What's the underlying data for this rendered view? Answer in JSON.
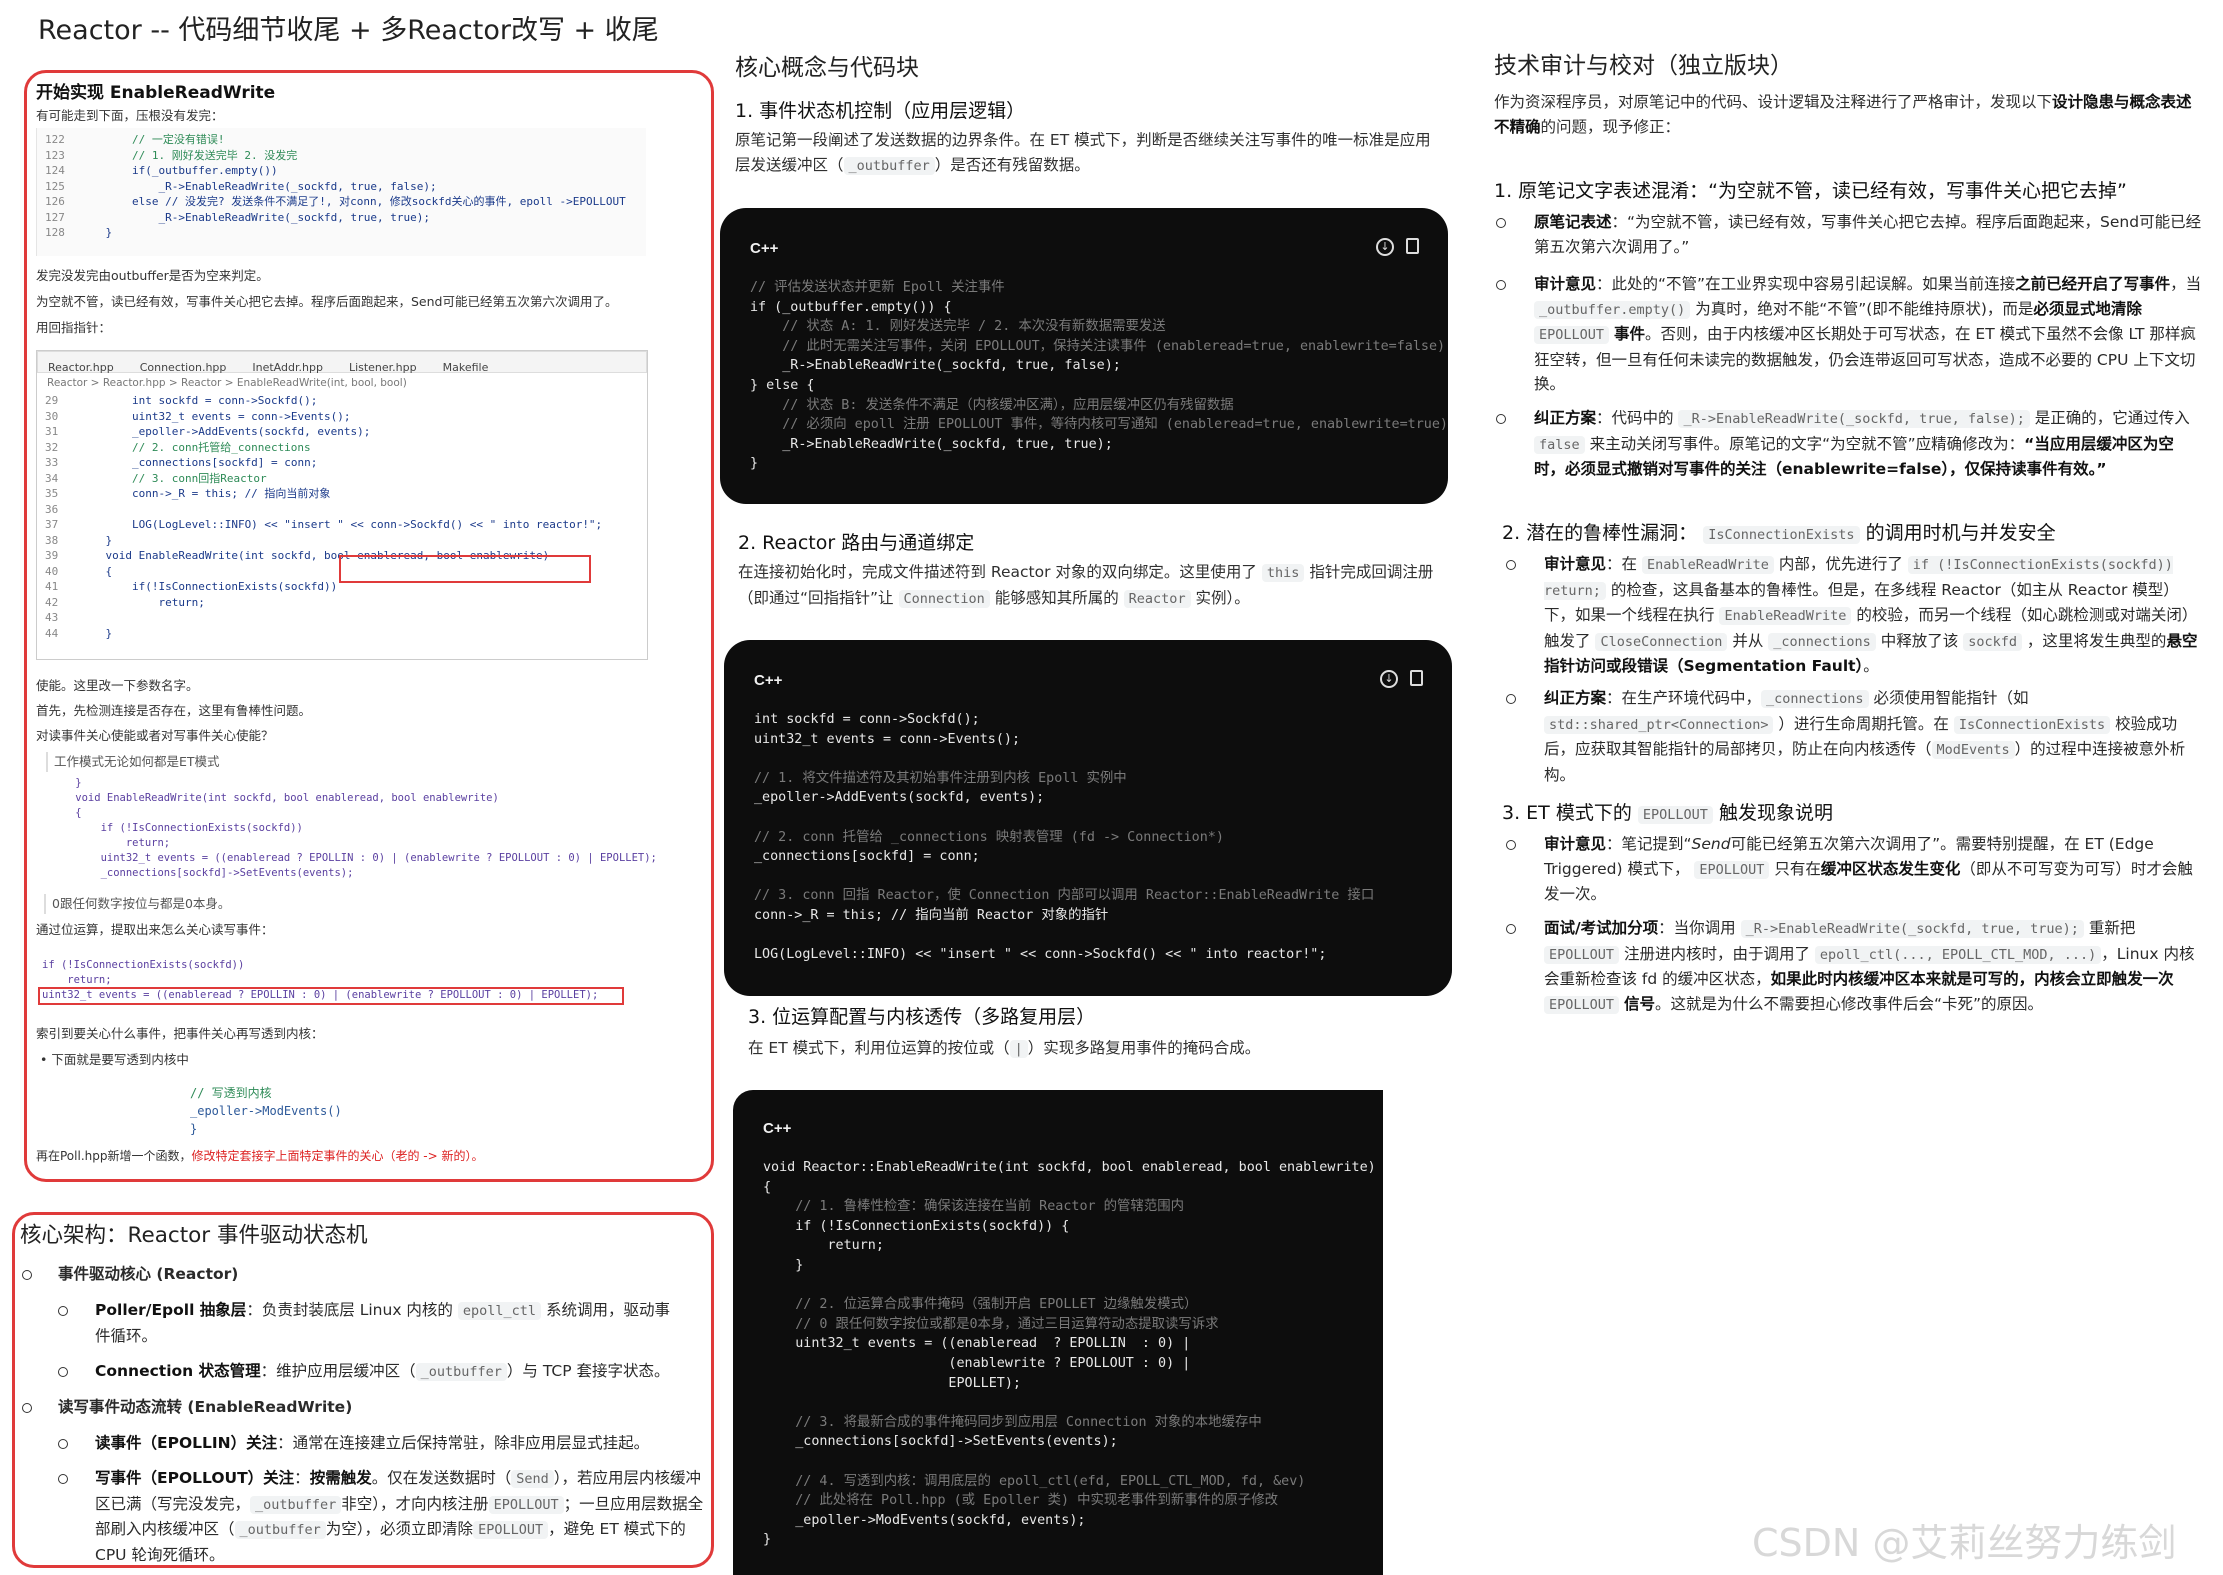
{
  "page_title": "Reactor -- 代码细节收尾 + 多Reactor改写 + 收尾",
  "watermark": "CSDN @艾莉丝努力练剑",
  "left_panel": {
    "heading": "开始实现 EnableReadWrite",
    "intro": "有可能走到下面，压根没有发完：",
    "code1": [
      {
        "n": "122",
        "t": "        // 一定没有错误!"
      },
      {
        "n": "123",
        "t": "        // 1. 刚好发送完毕 2. 没发完"
      },
      {
        "n": "124",
        "t": "        if(_outbuffer.empty())"
      },
      {
        "n": "125",
        "t": "            _R->EnableReadWrite(_sockfd, true, false);"
      },
      {
        "n": "126",
        "t": "        else // 没发完? 发送条件不满足了!, 对conn, 修改sockfd关心的事件, epoll ->EPOLLOUT"
      },
      {
        "n": "127",
        "t": "            _R->EnableReadWrite(_sockfd, true, true);"
      },
      {
        "n": "128",
        "t": "    }"
      }
    ],
    "p1": "发完没发完由outbuffer是否为空来判定。",
    "p2": "为空就不管，读已经有效，写事件关心把它去掉。程序后面跑起来，Send可能已经第五次第六次调用了。",
    "p3": "用回指指针：",
    "tabs": [
      "Reactor.hpp",
      "Connection.hpp",
      "InetAddr.hpp",
      "Listener.hpp",
      "Makefile"
    ],
    "crumbs": "Reactor > Reactor.hpp > Reactor > EnableReadWrite(int, bool, bool)",
    "code2": [
      {
        "n": "29",
        "t": "        int sockfd = conn->Sockfd();"
      },
      {
        "n": "30",
        "t": "        uint32_t events = conn->Events();"
      },
      {
        "n": "31",
        "t": "        _epoller->AddEvents(sockfd, events);"
      },
      {
        "n": "32",
        "t": "        // 2. conn托管给_connections"
      },
      {
        "n": "33",
        "t": "        _connections[sockfd] = conn;"
      },
      {
        "n": "34",
        "t": "        // 3. conn回指Reactor"
      },
      {
        "n": "35",
        "t": "        conn->_R = this; // 指向当前对象"
      },
      {
        "n": "36",
        "t": ""
      },
      {
        "n": "37",
        "t": "        LOG(LogLevel::INFO) << \"insert \" << conn->Sockfd() << \" into reactor!\";"
      },
      {
        "n": "38",
        "t": "    }"
      },
      {
        "n": "39",
        "t": "    void EnableReadWrite(int sockfd, bool enableread, bool enablewrite)"
      },
      {
        "n": "40",
        "t": "    {"
      },
      {
        "n": "41",
        "t": "        if(!IsConnectionExists(sockfd))"
      },
      {
        "n": "42",
        "t": "            return;"
      },
      {
        "n": "43",
        "t": ""
      },
      {
        "n": "44",
        "t": "    }"
      }
    ],
    "p4": "使能。这里改一下参数名字。",
    "p5": "首先，先检测连接是否存在，这里有鲁棒性问题。",
    "p6": "对读事件关心使能或者对写事件关心使能？",
    "p7": "工作模式无论如何都是ET模式",
    "code3": [
      "    }",
      "    void EnableReadWrite(int sockfd, bool enableread, bool enablewrite)",
      "    {",
      "        if (!IsConnectionExists(sockfd))",
      "            return;",
      "        uint32_t events = ((enableread ? EPOLLIN : 0) | (enablewrite ? EPOLLOUT : 0) | EPOLLET);",
      "        _connections[sockfd]->SetEvents(events);"
    ],
    "p8": "0跟任何数字按位与都是0本身。",
    "p9": "通过位运算，提取出来怎么关心读写事件：",
    "code4": [
      "if (!IsConnectionExists(sockfd))",
      "    return;",
      "uint32_t events = ((enableread ? EPOLLIN : 0) | (enablewrite ? EPOLLOUT : 0) | EPOLLET);"
    ],
    "p10": "索引到要关心什么事件，把事件关心再写透到内核：",
    "p11": "下面就是要写透到内核中",
    "code5": [
      "// 写透到内核",
      "_epoller->ModEvents()",
      "}"
    ],
    "p12a": "再在Poll.hpp新增一个函数，",
    "p12b": "修改特定套接字上面特定事件的关心（老的 -> 新的）。"
  },
  "arch_panel": {
    "heading": "核心架构：Reactor 事件驱动状态机",
    "l1": "事件驱动核心 (Reactor)",
    "l1a_b": "Poller/Epoll 抽象层",
    "l1a_t1": "：负责封装底层 Linux 内核的",
    "l1a_code": "epoll_ctl",
    "l1a_t2": "系统调用，驱动事件循环。",
    "l1b_b": "Connection 状态管理",
    "l1b_t1": "：维护应用层缓冲区（",
    "l1b_code": "_outbuffer",
    "l1b_t2": "）与 TCP 套接字状态。",
    "l2": "读写事件动态流转 (EnableReadWrite)",
    "l2a_b": "读事件（EPOLLIN）关注",
    "l2a_t": "：通常在连接建立后保持常驻，除非应用层显式挂起。",
    "l2b_b1": "写事件（EPOLLOUT）关注",
    "l2b_b2": "按需触发",
    "l2b_t1": "。仅在发送数据时（",
    "l2b_c1": "Send",
    "l2b_t2": "），若应用层内核缓冲区已满（写完没发完，",
    "l2b_c2": "_outbuffer",
    "l2b_t3": "非空），才向内核注册",
    "l2b_c3": "EPOLLOUT",
    "l2b_t4": "；一旦应用层数据全部刷入内核缓冲区（",
    "l2b_c4": "_outbuffer",
    "l2b_t5": "为空），必须立即清除",
    "l2b_c5": "EPOLLOUT",
    "l2b_t6": "，避免 ET 模式下的 CPU 轮询死循环。"
  },
  "middle": {
    "heading": "核心概念与代码块",
    "s1_title": "1. 事件状态机控制（应用层逻辑）",
    "s1_para_a": "原笔记第一段阐述了发送数据的边界条件。在 ET 模式下，判断是否继续关注写事件的唯一标准是应用层发送缓冲区（",
    "s1_code": "_outbuffer",
    "s1_para_b": "）是否还有残留数据。",
    "lang": "C++",
    "code1": [
      "// 评估发送状态并更新 Epoll 关注事件",
      "if (_outbuffer.empty()) {",
      "    // 状态 A: 1. 刚好发送完毕 / 2. 本次没有新数据需要发送",
      "    // 此时无需关注写事件，关闭 EPOLLOUT，保持关注读事件 (enableread=true, enablewrite=false)",
      "    _R->EnableReadWrite(_sockfd, true, false);",
      "} else {",
      "    // 状态 B: 发送条件不满足（内核缓冲区满），应用层缓冲区仍有残留数据",
      "    // 必须向 epoll 注册 EPOLLOUT 事件，等待内核可写通知 (enableread=true, enablewrite=true)",
      "    _R->EnableReadWrite(_sockfd, true, true);",
      "}"
    ],
    "s2_title": "2. Reactor 路由与通道绑定",
    "s2_para_a": "在连接初始化时，完成文件描述符到 Reactor 对象的双向绑定。这里使用了",
    "s2_code1": "this",
    "s2_para_b": "指针完成回调注册（即通过“回指指针”让",
    "s2_code2": "Connection",
    "s2_para_c": "能够感知其所属的",
    "s2_code3": "Reactor",
    "s2_para_d": "实例）。",
    "code2": [
      "int sockfd = conn->Sockfd();",
      "uint32_t events = conn->Events();",
      "",
      "// 1. 将文件描述符及其初始事件注册到内核 Epoll 实例中",
      "_epoller->AddEvents(sockfd, events);",
      "",
      "// 2. conn 托管给 _connections 映射表管理 (fd -> Connection*)",
      "_connections[sockfd] = conn;",
      "",
      "// 3. conn 回指 Reactor，使 Connection 内部可以调用 Reactor::EnableReadWrite 接口",
      "conn->_R = this; // 指向当前 Reactor 对象的指针",
      "",
      "LOG(LogLevel::INFO) << \"insert \" << conn->Sockfd() << \" into reactor!\";"
    ],
    "s3_title": "3. 位运算配置与内核透传（多路复用层）",
    "s3_para_a": "在 ET 模式下，利用位运算的按位或（",
    "s3_code": "|",
    "s3_para_b": "）实现多路复用事件的掩码合成。",
    "code3": [
      "void Reactor::EnableReadWrite(int sockfd, bool enableread, bool enablewrite)",
      "{",
      "    // 1. 鲁棒性检查：确保该连接在当前 Reactor 的管辖范围内",
      "    if (!IsConnectionExists(sockfd)) {",
      "        return;",
      "    }",
      "",
      "    // 2. 位运算合成事件掩码（强制开启 EPOLLET 边缘触发模式）",
      "    // 0 跟任何数字按位或都是0本身，通过三目运算符动态提取读写诉求",
      "    uint32_t events = ((enableread  ? EPOLLIN  : 0) |",
      "                       (enablewrite ? EPOLLOUT : 0) |",
      "                       EPOLLET);",
      "",
      "    // 3. 将最新合成的事件掩码同步到应用层 Connection 对象的本地缓存中",
      "    _connections[sockfd]->SetEvents(events);",
      "",
      "    // 4. 写透到内核：调用底层的 epoll_ctl(efd, EPOLL_CTL_MOD, fd, &ev)",
      "    // 此处将在 Poll.hpp (或 Epoller 类) 中实现老事件到新事件的原子修改",
      "    _epoller->ModEvents(sockfd, events);",
      "}"
    ]
  },
  "right": {
    "heading": "技术审计与校对（独立版块）",
    "intro_a": "作为资深程序员，对原笔记中的代码、设计逻辑及注释进行了严格审计，发现以下",
    "intro_b": "设计隐患与概念表述不精确",
    "intro_c": "的问题，现予修正：",
    "i1_title": "1. 原笔记文字表述混淆：“为空就不管，读已经有效，写事件关心把它去掉”",
    "i1_a_b": "原笔记表述",
    "i1_a_t": "：“为空就不管，读已经有效，写事件关心把它去掉。程序后面跑起来，Send可能已经第五次第六次调用了。”",
    "i1_b_b": "审计意见",
    "i1_b_t1": "：此处的“不管”在工业界实现中容易引起误解。如果当前连接",
    "i1_b_b2": "之前已经开启了写事件",
    "i1_b_t2": "，当",
    "i1_b_c1": "_outbuffer.empty()",
    "i1_b_t3": "为真时，绝对不能“不管”(即不能维持原状)，而是",
    "i1_b_b3": "必须显式地清除",
    "i1_b_c2": "EPOLLOUT",
    "i1_b_b4": "事件",
    "i1_b_t4": "。否则，由于内核缓冲区长期处于可写状态，在 ET 模式下虽然不会像 LT 那样疯狂空转，但一旦有任何未读完的数据触发，仍会连带返回可写状态，造成不必要的 CPU 上下文切换。",
    "i1_c_b": "纠正方案",
    "i1_c_t1": "：代码中的",
    "i1_c_c1": "_R->EnableReadWrite(_sockfd, true, false);",
    "i1_c_t2": "是正确的，它通过传入",
    "i1_c_c2": "false",
    "i1_c_t3": "来主动关闭写事件。原笔记的文字“为空就不管”应精确修改为：",
    "i1_c_b2": "“当应用层缓冲区为空时，必须显式撤销对写事件的关注（enablewrite=false），仅保持读事件有效。”",
    "i2_title_a": "2. 潜在的鲁棒性漏洞：",
    "i2_title_code": "IsConnectionExists",
    "i2_title_b": "的调用时机与并发安全",
    "i2_a_b": "审计意见",
    "i2_a_t1": "：在",
    "i2_a_c1": "EnableReadWrite",
    "i2_a_t2": "内部，优先进行了",
    "i2_a_c2": "if (!IsConnectionExists(sockfd)) return;",
    "i2_a_t3": "的检查，这具备基本的鲁棒性。但是，在多线程 Reactor（如主从 Reactor 模型）下，如果一个线程在执行",
    "i2_a_c3": "EnableReadWrite",
    "i2_a_t4": "的校验，而另一个线程（如心跳检测或对端关闭）触发了",
    "i2_a_c4": "CloseConnection",
    "i2_a_t5": "并从",
    "i2_a_c5": "_connections",
    "i2_a_t6": "中释放了该",
    "i2_a_c6": "sockfd",
    "i2_a_t7": "，这里将发生典型的",
    "i2_a_b2": "悬空指针访问或段错误（Segmentation Fault）",
    "i2_a_t8": "。",
    "i2_b_b": "纠正方案",
    "i2_b_t1": "：在生产环境代码中，",
    "i2_b_c1": "_connections",
    "i2_b_t2": "必须使用智能指针（如",
    "i2_b_c2": "std::shared_ptr<Connection>",
    "i2_b_t3": "）进行生命周期托管。在",
    "i2_b_c3": "IsConnectionExists",
    "i2_b_t4": "校验成功后，应获取其智能指针的局部拷贝，防止在向内核透传（",
    "i2_b_c4": "ModEvents",
    "i2_b_t5": "）的过程中连接被意外析构。",
    "i3_title_a": "3. ET 模式下的",
    "i3_title_code": "EPOLLOUT",
    "i3_title_b": "触发现象说明",
    "i3_a_b": "审计意见",
    "i3_a_t1": "：笔记提到“",
    "i3_a_i": "Send",
    "i3_a_t2": "可能已经第五次第六次调用了”。需要特别提醒，在 ET (Edge Triggered) 模式下，",
    "i3_a_c1": "EPOLLOUT",
    "i3_a_t3": "只有在",
    "i3_a_b2": "缓冲区状态发生变化",
    "i3_a_t4": "（即从不可写变为可写）时才会触发一次。",
    "i3_b_b": "面试/考试加分项",
    "i3_b_t1": "：当你调用",
    "i3_b_c1": "_R->EnableReadWrite(_sockfd, true, true);",
    "i3_b_t2": "重新把",
    "i3_b_c2": "EPOLLOUT",
    "i3_b_t3": "注册进内核时，由于调用了",
    "i3_b_c3": "epoll_ctl(..., EPOLL_CTL_MOD, ...)",
    "i3_b_t4": "，Linux 内核会重新检查该 fd 的缓冲区状态，",
    "i3_b_b2": "如果此时内核缓冲区本来就是可写的，内核会立即触发一次",
    "i3_b_c4": "EPOLLOUT",
    "i3_b_b3": "信号",
    "i3_b_t5": "。这就是为什么不需要担心修改事件后会“卡死”的原因。"
  }
}
